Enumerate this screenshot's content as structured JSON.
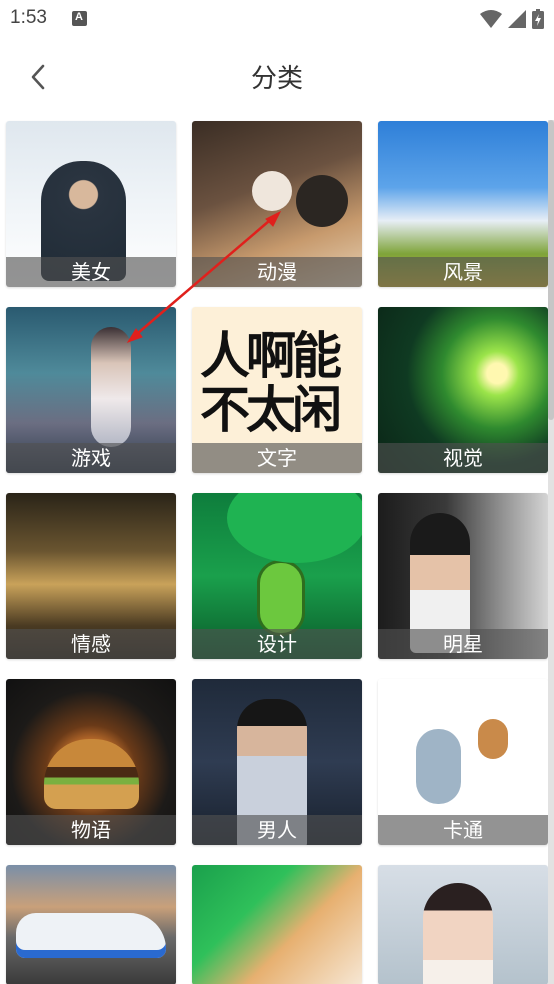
{
  "status_bar": {
    "time": "1:53",
    "notification_icon": "app-notification-icon",
    "wifi_icon": "wifi-icon",
    "signal_icon": "cell-signal-icon",
    "battery_icon": "battery-charging-icon"
  },
  "header": {
    "back_icon": "chevron-left-icon",
    "title": "分类"
  },
  "categories": [
    {
      "label": "美女"
    },
    {
      "label": "动漫"
    },
    {
      "label": "风景"
    },
    {
      "label": "游戏"
    },
    {
      "label": "文字"
    },
    {
      "label": "视觉"
    },
    {
      "label": "情感"
    },
    {
      "label": "设计"
    },
    {
      "label": "明星"
    },
    {
      "label": "物语"
    },
    {
      "label": "男人"
    },
    {
      "label": "卡通"
    }
  ],
  "text_card_art": "人啊能不太闲",
  "annotation": {
    "color": "#e0201c",
    "icon": "red-arrow-annotation"
  }
}
